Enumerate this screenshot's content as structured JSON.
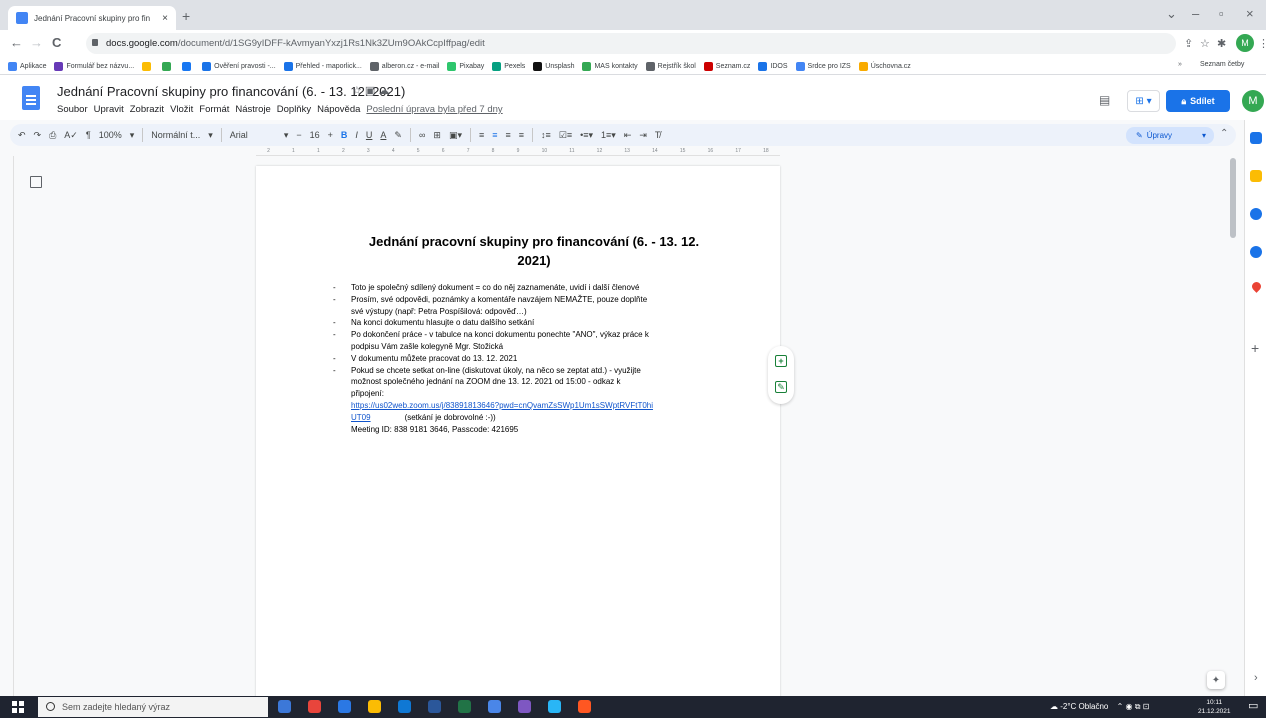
{
  "browser": {
    "tab_title": "Jednání Pracovní skupiny pro fin",
    "tab_close": "×",
    "new_tab": "+",
    "window_minimize": "–",
    "window_restore": "▫",
    "window_close": "×",
    "window_dropdown": "⌄",
    "back": "←",
    "forward": "→",
    "reload": "C",
    "url_domain": "docs.google.com",
    "url_path": "/document/d/1SG9yIDFF-kAvmyanYxzj1Rs1Nk3ZUm9OAkCcpIffpag/edit",
    "profile_initial": "M"
  },
  "bookmarks": {
    "items": [
      {
        "label": "Aplikace",
        "color": "#4285f4"
      },
      {
        "label": "Formulář bez názvu...",
        "color": "#673ab7"
      },
      {
        "label": "",
        "color": "#fbbc04"
      },
      {
        "label": "",
        "color": "#34a853"
      },
      {
        "label": "",
        "color": "#1877f2"
      },
      {
        "label": "Ověření pravosti -...",
        "color": "#1a73e8"
      },
      {
        "label": "Přehled - maporlick...",
        "color": "#1a73e8"
      },
      {
        "label": "alberon.cz - e-mail",
        "color": "#5f6368"
      },
      {
        "label": "Pixabay",
        "color": "#2ec66d"
      },
      {
        "label": "Pexels",
        "color": "#05a081"
      },
      {
        "label": "Unsplash",
        "color": "#111111"
      },
      {
        "label": "MAS kontakty",
        "color": "#34a853"
      },
      {
        "label": "Rejstřík škol",
        "color": "#5f6368"
      },
      {
        "label": "Seznam.cz",
        "color": "#cc0000"
      },
      {
        "label": "IDOS",
        "color": "#1a73e8"
      },
      {
        "label": "Srdce pro IZS",
        "color": "#4285f4"
      },
      {
        "label": "Úschovna.cz",
        "color": "#f9ab00"
      }
    ],
    "more": "»",
    "reading_list": "Seznam četby"
  },
  "docs": {
    "title": "Jednání Pracovní skupiny pro financování (6. - 13. 12. 2021)",
    "menu": [
      "Soubor",
      "Upravit",
      "Zobrazit",
      "Vložit",
      "Formát",
      "Nástroje",
      "Doplňky",
      "Nápověda"
    ],
    "last_edit": "Poslední úprava byla před 7 dny",
    "share_label": "Sdílet",
    "avatar_initial": "M",
    "toolbar": {
      "zoom": "100%",
      "style": "Normální t...",
      "font": "Arial",
      "font_size": "16",
      "bold": "B",
      "italic": "I",
      "underline": "U",
      "text_color": "A",
      "edit_mode": "Úpravy"
    },
    "ruler": [
      "2",
      "1",
      "1",
      "2",
      "3",
      "4",
      "5",
      "6",
      "7",
      "8",
      "9",
      "10",
      "11",
      "12",
      "13",
      "14",
      "15",
      "16",
      "17",
      "18"
    ],
    "heading_line1": "Jednání pracovní skupiny pro financování (6. - 13. 12.",
    "heading_line2": "2021)",
    "bullets": [
      "Toto je společný sdílený dokument = co do něj zaznamenáte, uvidí i další členové",
      "Prosím, své odpovědi, poznámky a komentáře navzájem NEMAŽTE, pouze doplňte",
      "Na konci dokumentu hlasujte o datu dalšího setkání",
      "Po dokončení práce - v tabulce na konci dokumentu ponechte \"ANO\", výkaz práce k",
      "V dokumentu můžete pracovat do 13. 12. 2021",
      "Pokud se chcete setkat on-line (diskutovat úkoly, na něco se zeptat atd.) - využijte"
    ],
    "continuations": {
      "b2": "své výstupy (např: Petra Pospíšilová: odpověď…)",
      "b4": "podpisu Vám zašle kolegyně Mgr. Stožická",
      "b6a": "možnost společného jednání na ZOOM dne 13. 12. 2021 od 15:00 - odkaz k",
      "b6b": "připojení:",
      "link1": "https://us02web.zoom.us/j/83891813646?pwd=cnQvamZsSWp1Um1sSWptRVFtT0hi",
      "link2": "UT09",
      "voluntary": "(setkání je dobrovolné :-))",
      "meeting": "Meeting ID: 838 9181 3646, Passcode: 421695"
    }
  },
  "taskbar": {
    "search_placeholder": "Sem zadejte hledaný výraz",
    "weather": "-2°C Oblačno",
    "time": "10:11",
    "date": "21.12.2021",
    "apps": [
      "#3c78d8",
      "#e8453c",
      "#2b78e4",
      "#fbbc04",
      "#0f78d4",
      "#2b579a",
      "#217346",
      "#4a86e8",
      "#7e57c2",
      "#29b6f6",
      "#ff5722"
    ]
  }
}
